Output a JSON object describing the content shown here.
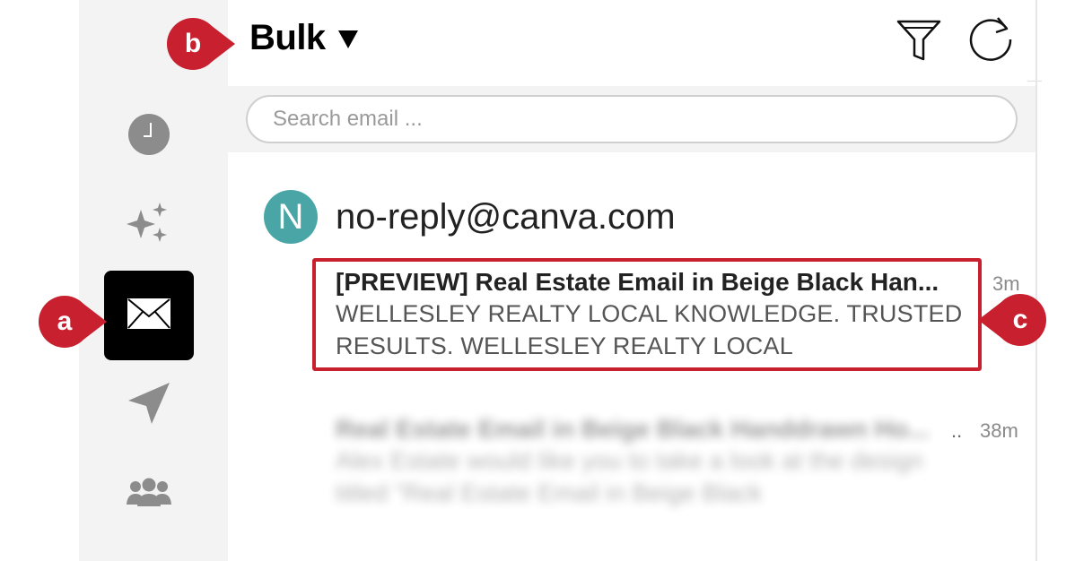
{
  "header": {
    "folder_label": "Bulk",
    "filter_icon": "funnel-icon",
    "refresh_icon": "refresh-icon"
  },
  "sidebar": {
    "items": [
      {
        "icon": "clock-icon",
        "active": false
      },
      {
        "icon": "sparkles-icon",
        "active": false
      },
      {
        "icon": "envelope-icon",
        "active": true
      },
      {
        "icon": "paper-plane-icon",
        "active": false
      },
      {
        "icon": "people-icon",
        "active": false
      }
    ]
  },
  "search": {
    "placeholder": "Search email ..."
  },
  "thread": {
    "avatar_letter": "N",
    "avatar_color": "#4aa6a6",
    "sender": "no-reply@canva.com",
    "messages": [
      {
        "subject": "[PREVIEW] Real Estate Email in Beige Black Han...",
        "preview": "WELLESLEY REALTY LOCAL KNOWLEDGE. TRUSTED RESULTS. WELLESLEY REALTY LOCAL",
        "time": "3m"
      },
      {
        "subject": "Real Estate Email in Beige Black Handdrawn Ho...",
        "preview": "Alex Estate would like you to take a look at the design titled \"Real Estate Email in Beige Black",
        "time": "38m"
      }
    ]
  },
  "callouts": {
    "a": "a",
    "b": "b",
    "c": "c",
    "color": "#c8202f"
  }
}
